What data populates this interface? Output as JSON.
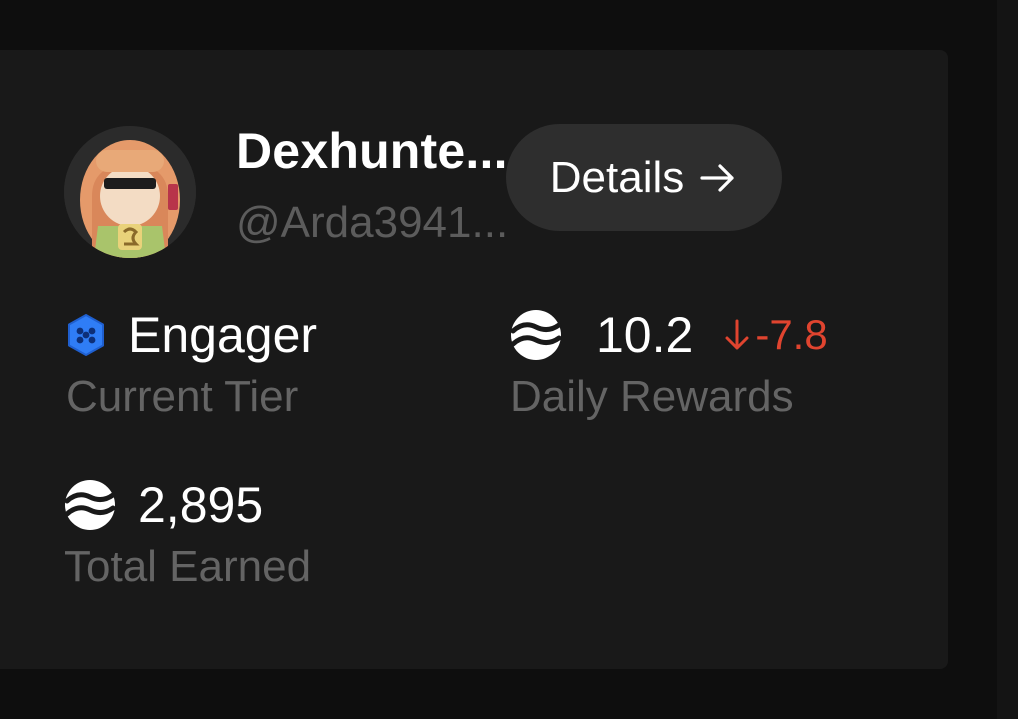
{
  "profile": {
    "display_name": "Dexhunte...",
    "username": "@Arda3941..."
  },
  "actions": {
    "details_label": "Details",
    "details_icon": "arrow-right-icon"
  },
  "stats": {
    "tier": {
      "value": "Engager",
      "label": "Current Tier",
      "icon": "hexagon-badge-icon",
      "icon_color": "#2f7df6"
    },
    "daily_rewards": {
      "value": "10.2",
      "label": "Daily Rewards",
      "icon": "wave-token-icon",
      "delta": "-7.8",
      "delta_icon": "arrow-down-icon",
      "delta_color": "#e0442f"
    },
    "total_earned": {
      "value": "2,895",
      "label": "Total Earned",
      "icon": "wave-token-icon"
    }
  },
  "colors": {
    "background": "#0e0e0e",
    "card": "#191919",
    "button": "#2e2e2e",
    "muted_text": "#646464",
    "negative": "#e0442f",
    "tier_blue": "#2f7df6"
  }
}
